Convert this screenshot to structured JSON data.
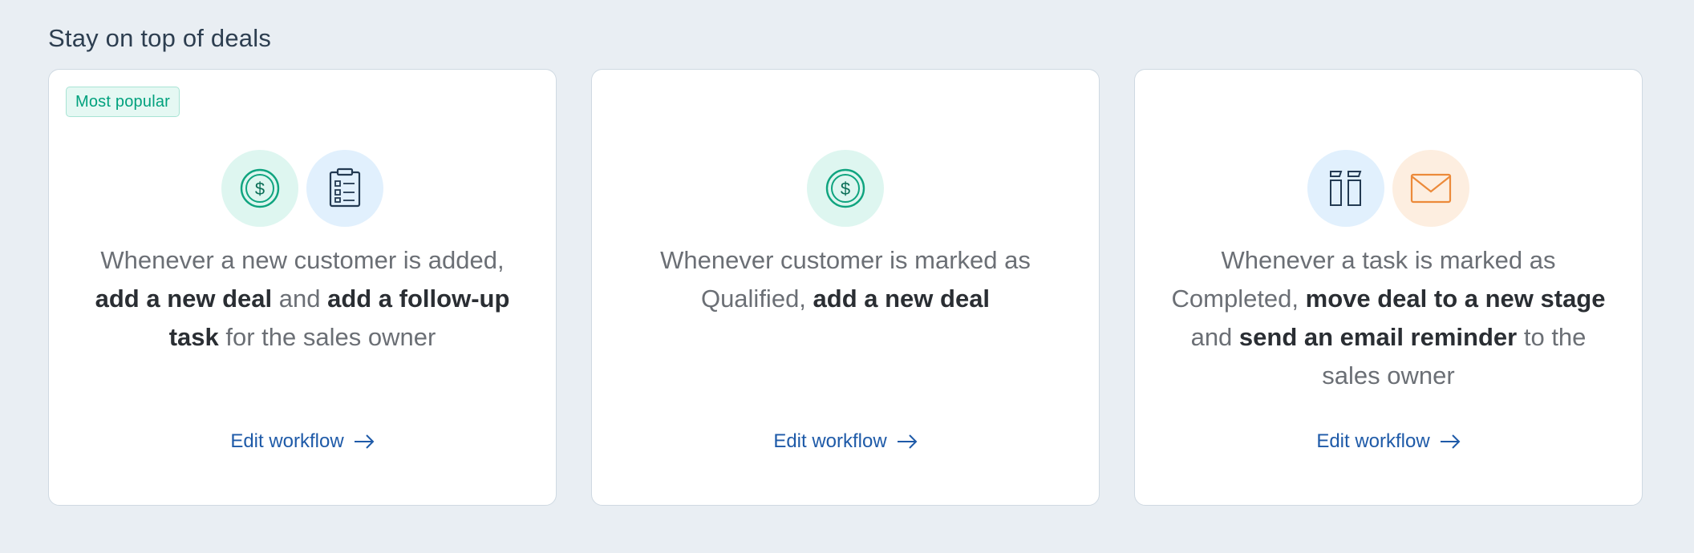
{
  "section": {
    "title": "Stay on top of deals"
  },
  "cards": [
    {
      "badge": "Most popular",
      "icons": [
        "dollar-coin-icon",
        "clipboard-checklist-icon"
      ],
      "description": [
        {
          "text": "Whenever a new customer is added, ",
          "bold": false
        },
        {
          "text": "add a new deal",
          "bold": true
        },
        {
          "text": " and ",
          "bold": false
        },
        {
          "text": "add a follow-up task",
          "bold": true
        },
        {
          "text": " for the sales owner",
          "bold": false
        }
      ],
      "link_label": "Edit workflow"
    },
    {
      "badge": "",
      "icons": [
        "dollar-coin-icon"
      ],
      "description": [
        {
          "text": "Whenever customer is marked as Qualified, ",
          "bold": false
        },
        {
          "text": "add a new deal",
          "bold": true
        }
      ],
      "link_label": "Edit workflow"
    },
    {
      "badge": "",
      "icons": [
        "pipeline-columns-icon",
        "envelope-icon"
      ],
      "description": [
        {
          "text": "Whenever a task is marked as Completed, ",
          "bold": false
        },
        {
          "text": "move deal to a new stage",
          "bold": true
        },
        {
          "text": " and ",
          "bold": false
        },
        {
          "text": "send an email reminder",
          "bold": true
        },
        {
          "text": " to the sales owner",
          "bold": false
        }
      ],
      "link_label": "Edit workflow"
    }
  ],
  "colors": {
    "background": "#e9eef3",
    "badge_text": "#00a17d",
    "link": "#1e5aa8",
    "icon_green_bg": "#def6f0",
    "icon_blue_bg": "#e1f0fd",
    "icon_orange_bg": "#fdeee0"
  }
}
